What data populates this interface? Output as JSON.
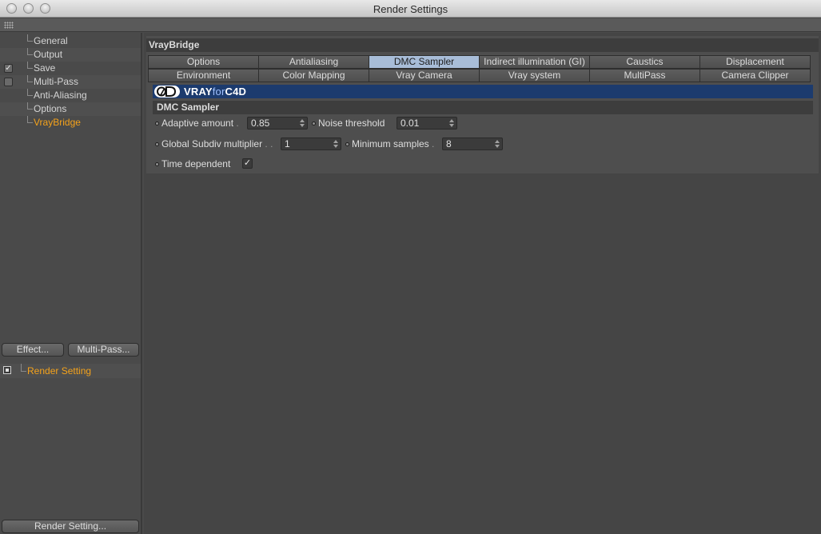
{
  "window": {
    "title": "Render Settings"
  },
  "sidebar": {
    "items": [
      {
        "label": "General",
        "checkbox": null
      },
      {
        "label": "Output",
        "checkbox": null
      },
      {
        "label": "Save",
        "checkbox": "✓"
      },
      {
        "label": "Multi-Pass",
        "checkbox": ""
      },
      {
        "label": "Anti-Aliasing",
        "checkbox": null
      },
      {
        "label": "Options",
        "checkbox": null
      },
      {
        "label": "VrayBridge",
        "checkbox": null
      }
    ],
    "effect_button": "Effect...",
    "multipass_button": "Multi-Pass...",
    "render_setting_label": "Render Setting",
    "render_setting_button": "Render Setting..."
  },
  "panel": {
    "title": "VrayBridge",
    "tabs_row1": [
      "Options",
      "Antialiasing",
      "DMC Sampler",
      "Indirect illumination (GI)",
      "Caustics",
      "Displacement"
    ],
    "tabs_row2": [
      "Environment",
      "Color Mapping",
      "Vray Camera",
      "Vray system",
      "MultiPass",
      "Camera Clipper"
    ],
    "active_tab": "DMC Sampler",
    "banner": {
      "brand_main": "VRAY",
      "brand_for": "for",
      "brand_c4d": "C4D",
      "logo_icon": "c4d-logo-icon"
    },
    "section_title": "DMC Sampler",
    "params": {
      "adaptive_amount": {
        "label": "Adaptive amount",
        "dots": ".",
        "value": "0.85"
      },
      "noise_threshold": {
        "label": "Noise threshold",
        "dots": "",
        "value": "0.01"
      },
      "global_subdiv": {
        "label": "Global Subdiv multiplier",
        "dots": ". .",
        "value": "1"
      },
      "min_samples": {
        "label": "Minimum samples",
        "dots": ".",
        "value": "8"
      },
      "time_dependent": {
        "label": "Time dependent",
        "dots": "",
        "checked": "✓"
      }
    }
  },
  "colors": {
    "active_item": "#f4a21b",
    "active_tab": "#a8bdd8",
    "banner": "#1c3b6e"
  }
}
